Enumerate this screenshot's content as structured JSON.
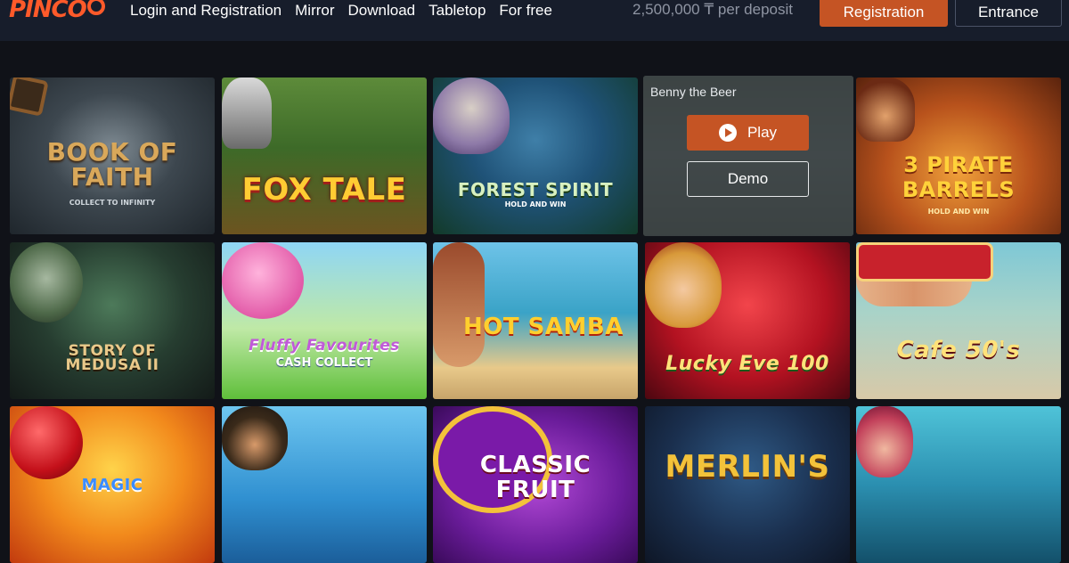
{
  "brand": {
    "logo_text": "PINCO"
  },
  "nav": [
    {
      "label": "Login and Registration"
    },
    {
      "label": "Mirror"
    },
    {
      "label": "Download"
    },
    {
      "label": "Tabletop"
    },
    {
      "label": "For free"
    }
  ],
  "header": {
    "promo": "2,500,000 ₸ per deposit",
    "registration_label": "Registration",
    "entrance_label": "Entrance"
  },
  "colors": {
    "accent": "#c55424",
    "header_bg": "#171d2b",
    "page_bg": "#101218"
  },
  "games": [
    {
      "title": "BOOK OF FAITH",
      "subtitle": "COLLECT TO INFINITY"
    },
    {
      "title": "FOX TALE",
      "subtitle": ""
    },
    {
      "title": "FOREST SPIRIT",
      "subtitle": "HOLD AND WIN"
    },
    {
      "title": "",
      "subtitle": ""
    },
    {
      "title": "3 PIRATE BARRELS",
      "subtitle": "HOLD AND WIN"
    },
    {
      "title": "STORY OF MEDUSA II",
      "subtitle": ""
    },
    {
      "title": "Fluffy Favourites",
      "subtitle": "CASH COLLECT"
    },
    {
      "title": "HOT SAMBA",
      "subtitle": ""
    },
    {
      "title": "Lucky Eve 100",
      "subtitle": ""
    },
    {
      "title": "Cafe 50's",
      "subtitle": ""
    },
    {
      "title": "MAGIC",
      "subtitle": ""
    },
    {
      "title": "",
      "subtitle": ""
    },
    {
      "title": "CLASSIC FRUIT",
      "subtitle": ""
    },
    {
      "title": "MERLIN'S",
      "subtitle": ""
    },
    {
      "title": "",
      "subtitle": ""
    }
  ],
  "hover_card": {
    "name": "Benny the Beer",
    "play_label": "Play",
    "demo_label": "Demo"
  }
}
